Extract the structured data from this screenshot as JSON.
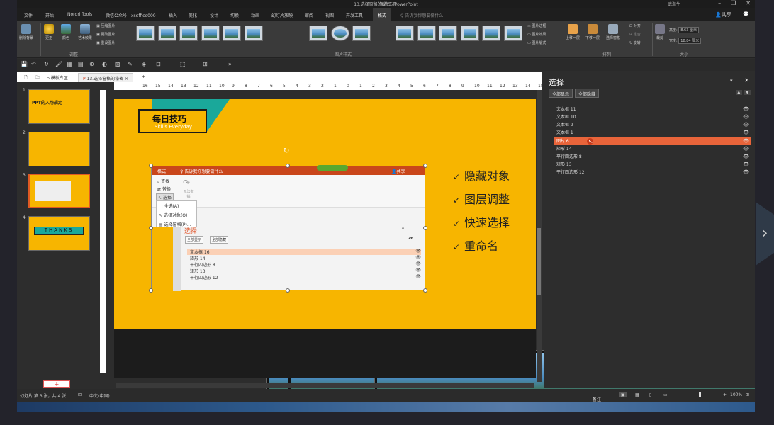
{
  "window": {
    "title": "13.选择窗格的秘密 - PowerPoint",
    "context_tab": "图片工具",
    "user": "武海生"
  },
  "ribbon_tabs": [
    "文件",
    "开始",
    "Nordri Tools",
    "微信公众号：xsoffice000",
    "插入",
    "美化",
    "设计",
    "切换",
    "动画",
    "幻灯片放映",
    "审阅",
    "视图",
    "开发工具",
    "格式"
  ],
  "ribbon_search": "告诉我你想要做什么",
  "share": "共享",
  "ribbon": {
    "remove_bg": "删除背景",
    "correct": "更正",
    "color": "颜色",
    "art_effects": "艺术效果",
    "compress": "压缩图片",
    "change_pic": "更改图片",
    "reset_pic": "重设图片",
    "group_adjust": "调整",
    "group_styles": "图片样式",
    "border": "图片边框",
    "effects": "图片效果",
    "layout": "图片版式",
    "bring_forward": "上移一层",
    "send_backward": "下移一层",
    "selection_pane": "选择窗格",
    "align": "对齐",
    "group": "组合",
    "rotate": "旋转",
    "group_arrange": "排列",
    "crop": "裁剪",
    "height_label": "高度:",
    "height_val": "8.63 厘米",
    "width_label": "宽度:",
    "width_val": "18.84 厘米",
    "group_size": "大小"
  },
  "doc_tabs": [
    "模板专区",
    "13.选择窗格的秘密"
  ],
  "slide_nums": [
    "1",
    "2",
    "3",
    "4"
  ],
  "thumb": {
    "t1": "PPT的入场规定",
    "t4": "THANKS"
  },
  "slide": {
    "tips_title": "每日技巧",
    "tips_sub": "Skills Everyday",
    "bullets": [
      "隐藏对象",
      "图层调整",
      "快速选择",
      "重命名"
    ],
    "check": "✓",
    "inner": {
      "tab": "格式",
      "search": "告诉我你想要做什么",
      "share": "共享",
      "find": "查找",
      "replace": "替换",
      "select": "选择",
      "undo": "无法撤销",
      "menu": [
        "全选(A)",
        "选择对象(O)",
        "选择窗格(P)..."
      ],
      "pane_title": "选择",
      "show_all": "全部显示",
      "hide_all": "全部隐藏",
      "rows": [
        "文本框 16",
        "矩形 14",
        "平行四边形 8",
        "矩形 13",
        "平行四边形 12"
      ]
    }
  },
  "pane": {
    "title": "选择",
    "show_all": "全部显示",
    "hide_all": "全部隐藏",
    "items": [
      "文本框 11",
      "文本框 10",
      "文本框 9",
      "文本框 1",
      "图片 6",
      "矩形 14",
      "平行四边形 8",
      "矩形 13",
      "平行四边形 12"
    ],
    "selected_index": 4
  },
  "status": {
    "slide_info": "幻灯片 第 3 张，共 4 张",
    "lang": "中文(中国)",
    "notes": "备注",
    "zoom": "100%"
  },
  "colors": {
    "slide_bg": "#f7b500",
    "accent": "#e8643a",
    "teal": "#1aa89a"
  }
}
